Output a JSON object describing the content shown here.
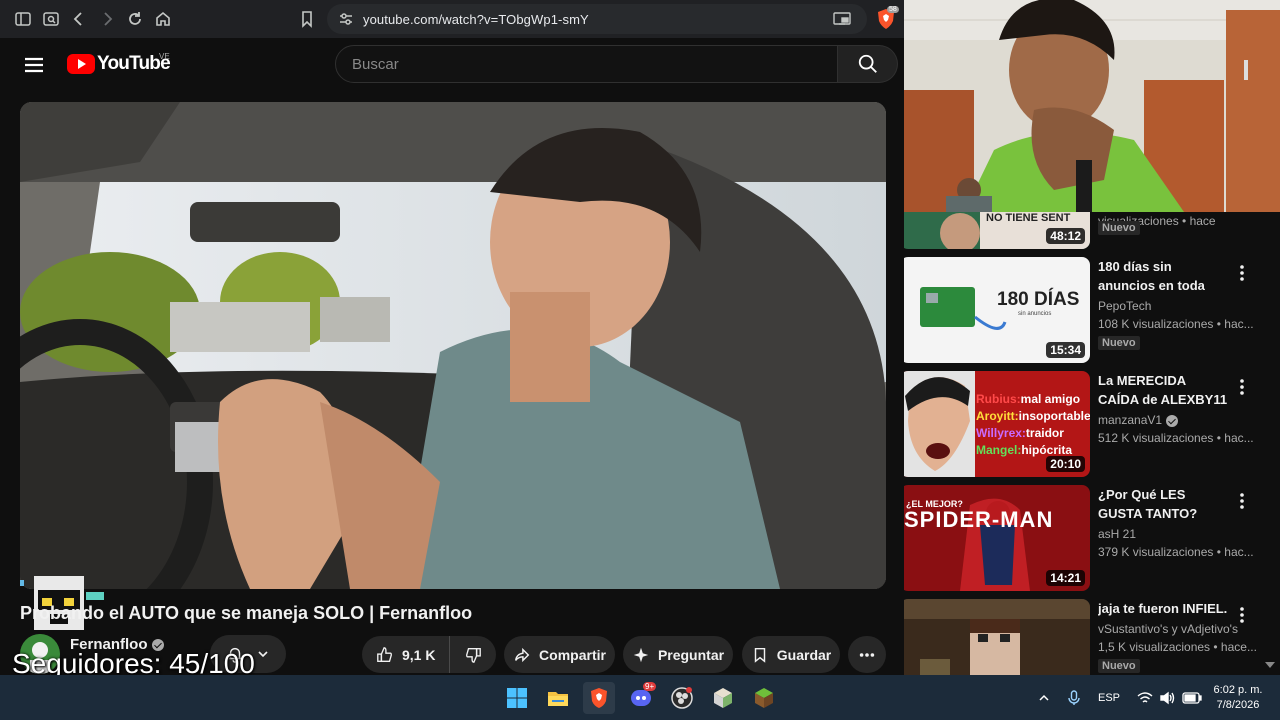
{
  "browser": {
    "url": "youtube.com/watch?v=TObgWp1-smY",
    "shield_badge": "58"
  },
  "youtube": {
    "logo_text": "YouTube",
    "country_code": "VE",
    "search_placeholder": "Buscar"
  },
  "video": {
    "title": "Probando el AUTO que se maneja SOLO | Fernanfloo",
    "channel": "Fernanfloo",
    "likes": "9,1 K",
    "share_label": "Compartir",
    "ask_label": "Preguntar",
    "save_label": "Guardar"
  },
  "overlay": {
    "followers": "Seguidores: 45/100"
  },
  "recommendations": [
    {
      "title": "",
      "channel": "",
      "views": "visualizaciones • hace",
      "duration": "48:12",
      "badge": "Nuevo",
      "thumb_text": "NO TIENE SENT"
    },
    {
      "title": "180 días sin anuncios en toda m...",
      "channel": "PepoTech",
      "views": "108 K visualizaciones • hac...",
      "duration": "15:34",
      "badge": "Nuevo",
      "thumb_text": "180 DÍAS",
      "thumb_subtext": "sin anuncios"
    },
    {
      "title": "La MERECIDA CAÍDA de ALEXBY11",
      "channel": "manzanaV1",
      "verified": true,
      "views": "512 K visualizaciones • hac...",
      "duration": "20:10",
      "badge": "",
      "thumb_lines": [
        {
          "name": "Rubius:",
          "text": "mal amigo",
          "color": "#ff4a4a"
        },
        {
          "name": "Aroyitt:",
          "text": "insoportable!",
          "color": "#ffde3a"
        },
        {
          "name": "Willyrex:",
          "text": "traidor",
          "color": "#c86bff"
        },
        {
          "name": "Mangel:",
          "text": "hipócrita",
          "color": "#63e05a"
        }
      ]
    },
    {
      "title": "¿Por Qué LES GUSTA TANTO? Spider-Ma...",
      "channel": "asH 21",
      "views": "379 K visualizaciones • hac...",
      "duration": "14:21",
      "badge": "",
      "thumb_text": "SPIDER-MAN",
      "thumb_subtext": "¿EL MEJOR?"
    },
    {
      "title": "jaja te fueron INFIEL.",
      "channel": "vSustantivo's y vAdjetivo's",
      "views": "1,5 K visualizaciones • hace...",
      "duration": "",
      "badge": "Nuevo"
    }
  ],
  "taskbar": {
    "discord_badge": "9+",
    "language": "ESP",
    "time": "6:02 p. m.",
    "date": "7/8/2026"
  },
  "colors": {
    "youtube_red": "#ff0000",
    "taskbar_bg": "#1c2b3a",
    "page_bg": "#0f0f0f",
    "pill_bg": "#272727"
  }
}
